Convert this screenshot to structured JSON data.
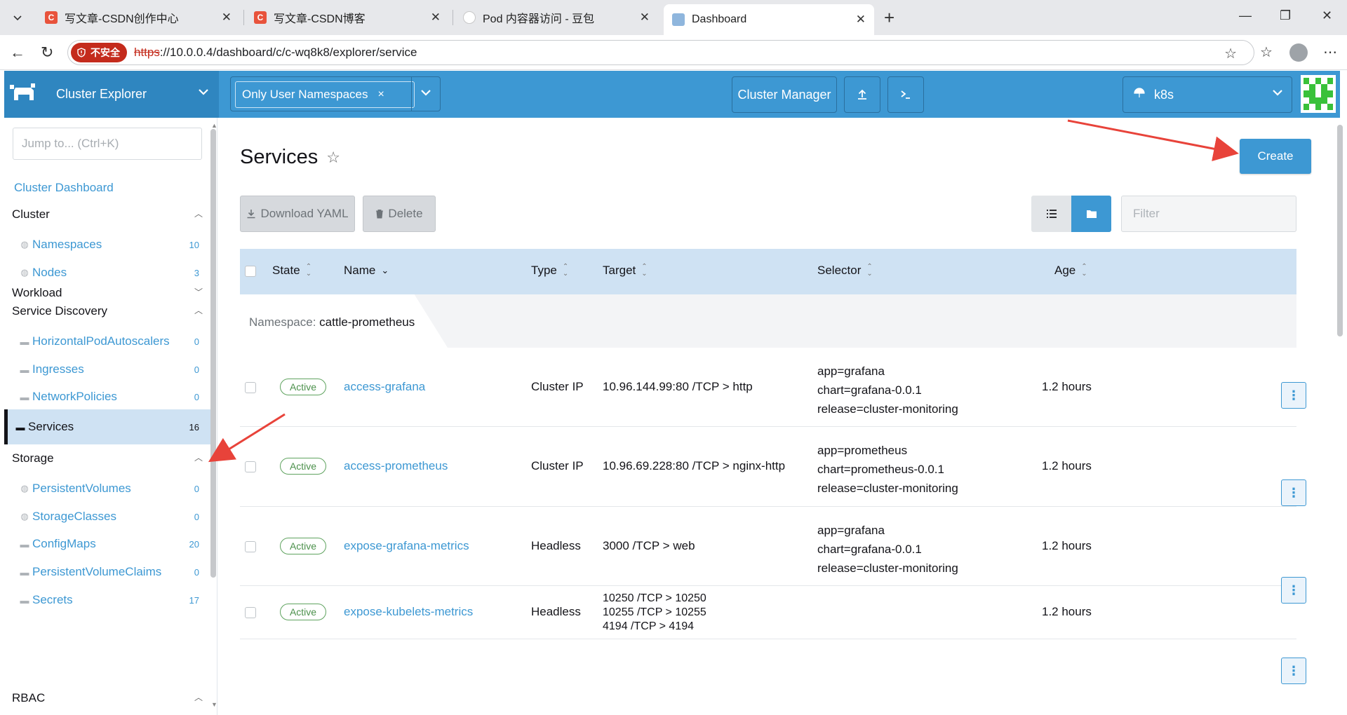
{
  "browser": {
    "tabs": [
      {
        "title": "写文章-CSDN创作中心",
        "favicon": "csdn-icon"
      },
      {
        "title": "写文章-CSDN博客",
        "favicon": "csdn-icon"
      },
      {
        "title": "Pod 内容器访问 - 豆包",
        "favicon": "doubao-icon"
      },
      {
        "title": "Dashboard",
        "favicon": "rancher-icon",
        "active": true
      }
    ],
    "insecure_label": "不安全",
    "url_scheme": "https",
    "url_rest": "://10.0.0.4/dashboard/c/c-wq8k8/explorer/service"
  },
  "header": {
    "product": "Cluster Explorer",
    "namespace_chip": "Only User Namespaces",
    "namespace_chip_remove": "×",
    "cluster_manager": "Cluster Manager",
    "cluster_name": "k8s",
    "accent": "#3d98d3"
  },
  "sidebar": {
    "jump_placeholder": "Jump to... (Ctrl+K)",
    "dashboard_link": "Cluster Dashboard",
    "groups": {
      "cluster": "Cluster",
      "workload": "Workload",
      "service_discovery": "Service Discovery",
      "storage": "Storage",
      "rbac": "RBAC"
    },
    "items": {
      "namespaces": {
        "label": "Namespaces",
        "count": "10"
      },
      "nodes": {
        "label": "Nodes",
        "count": "3"
      },
      "hpa": {
        "label": "HorizontalPodAutoscalers",
        "count": "0"
      },
      "ingresses": {
        "label": "Ingresses",
        "count": "0"
      },
      "networkpolicies": {
        "label": "NetworkPolicies",
        "count": "0"
      },
      "services": {
        "label": "Services",
        "count": "16"
      },
      "pv": {
        "label": "PersistentVolumes",
        "count": "0"
      },
      "storageclasses": {
        "label": "StorageClasses",
        "count": "0"
      },
      "configmaps": {
        "label": "ConfigMaps",
        "count": "20"
      },
      "pvc": {
        "label": "PersistentVolumeClaims",
        "count": "0"
      },
      "secrets": {
        "label": "Secrets",
        "count": "17"
      }
    }
  },
  "main": {
    "title": "Services",
    "create": "Create",
    "download_yaml": "Download YAML",
    "delete": "Delete",
    "filter_placeholder": "Filter",
    "columns": {
      "state": "State",
      "name": "Name",
      "type": "Type",
      "target": "Target",
      "selector": "Selector",
      "age": "Age"
    },
    "group_prefix": "Namespace:",
    "group_name": "cattle-prometheus",
    "rows": [
      {
        "state": "Active",
        "name": "access-grafana",
        "type": "Cluster IP",
        "target": [
          "10.96.144.99:80 /TCP > http"
        ],
        "selector": [
          "app=grafana",
          "chart=grafana-0.0.1",
          "release=cluster-monitoring"
        ],
        "age": "1.2 hours"
      },
      {
        "state": "Active",
        "name": "access-prometheus",
        "type": "Cluster IP",
        "target": [
          "10.96.69.228:80 /TCP > nginx-http"
        ],
        "selector": [
          "app=prometheus",
          "chart=prometheus-0.0.1",
          "release=cluster-monitoring"
        ],
        "age": "1.2 hours"
      },
      {
        "state": "Active",
        "name": "expose-grafana-metrics",
        "type": "Headless",
        "target": [
          "3000 /TCP > web"
        ],
        "selector": [
          "app=grafana",
          "chart=grafana-0.0.1",
          "release=cluster-monitoring"
        ],
        "age": "1.2 hours"
      },
      {
        "state": "Active",
        "name": "expose-kubelets-metrics",
        "type": "Headless",
        "target": [
          "10250 /TCP > 10250",
          "10255 /TCP > 10255",
          "4194 /TCP > 4194"
        ],
        "selector": [],
        "age": "1.2 hours"
      }
    ],
    "row_action_label": "⋮"
  }
}
